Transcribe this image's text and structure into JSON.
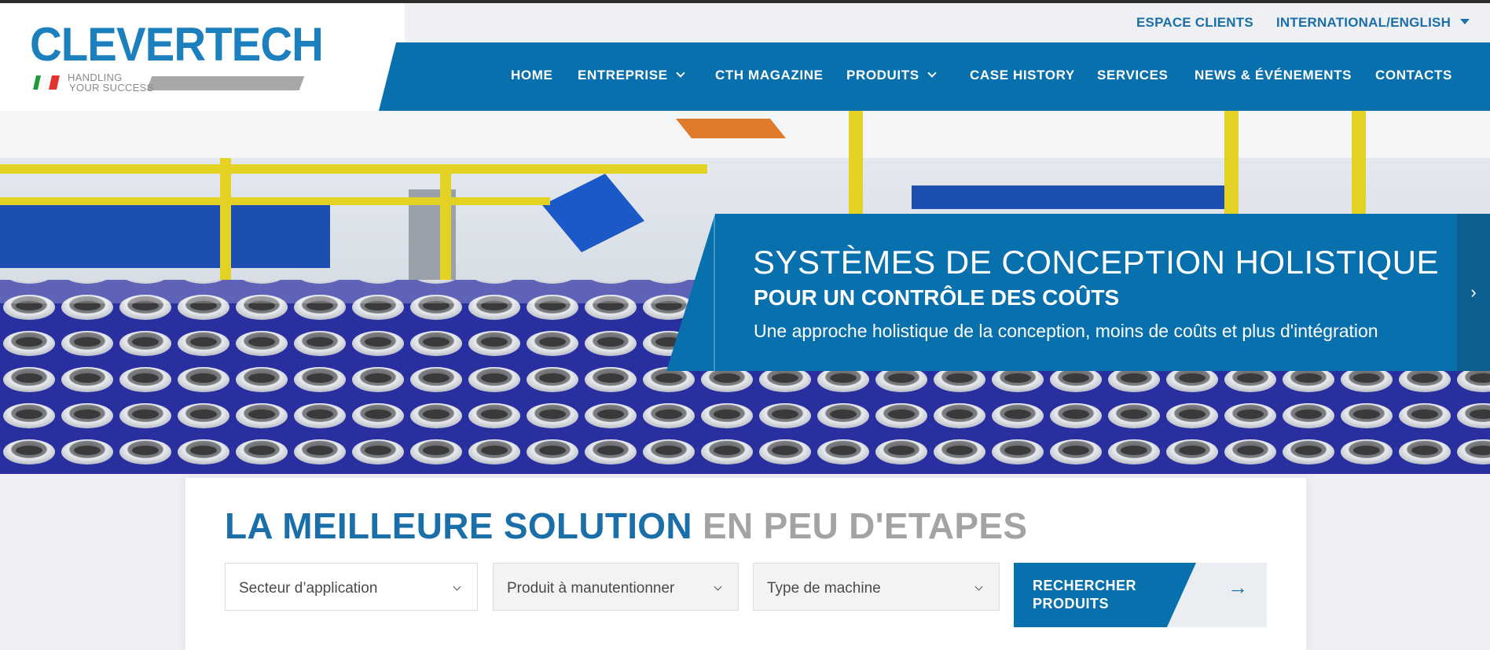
{
  "brand": {
    "name": "CLEVERTECH",
    "tagline_line1": "HANDLING",
    "tagline_line2": "YOUR SUCCESS"
  },
  "topbar": {
    "clients_label": "ESPACE CLIENTS",
    "language_label": "INTERNATIONAL/ENGLISH"
  },
  "nav": {
    "items": [
      {
        "label": "HOME",
        "has_dropdown": false
      },
      {
        "label": "ENTREPRISE",
        "has_dropdown": true
      },
      {
        "label": "CTH MAGAZINE",
        "has_dropdown": false
      },
      {
        "label": "PRODUITS",
        "has_dropdown": true
      },
      {
        "label": "CASE HISTORY",
        "has_dropdown": false
      },
      {
        "label": "SERVICES",
        "has_dropdown": false
      },
      {
        "label": "NEWS & ÉVÉNEMENTS",
        "has_dropdown": false
      },
      {
        "label": "CONTACTS",
        "has_dropdown": false
      }
    ]
  },
  "hero": {
    "title": "SYSTÈMES DE CONCEPTION HOLISTIQUE",
    "subtitle": "POUR UN CONTRÔLE DES COÛTS",
    "text": "Une approche holistique de la conception, moins de coûts et plus d'intégration",
    "next_icon": "chevron-right-icon"
  },
  "search": {
    "headline_part1": "LA MEILLEURE SOLUTION",
    "headline_part2": "EN PEU D'ETAPES",
    "filters": [
      {
        "placeholder": "Secteur d’application"
      },
      {
        "placeholder": "Produit à manutentionner"
      },
      {
        "placeholder": "Type de machine"
      }
    ],
    "button_label": "RECHERCHER PRODUITS",
    "button_icon": "arrow-right-icon"
  },
  "colors": {
    "brand_blue": "#0870ad",
    "link_blue": "#1b6fa8",
    "muted_gray": "#a3a3a3"
  }
}
